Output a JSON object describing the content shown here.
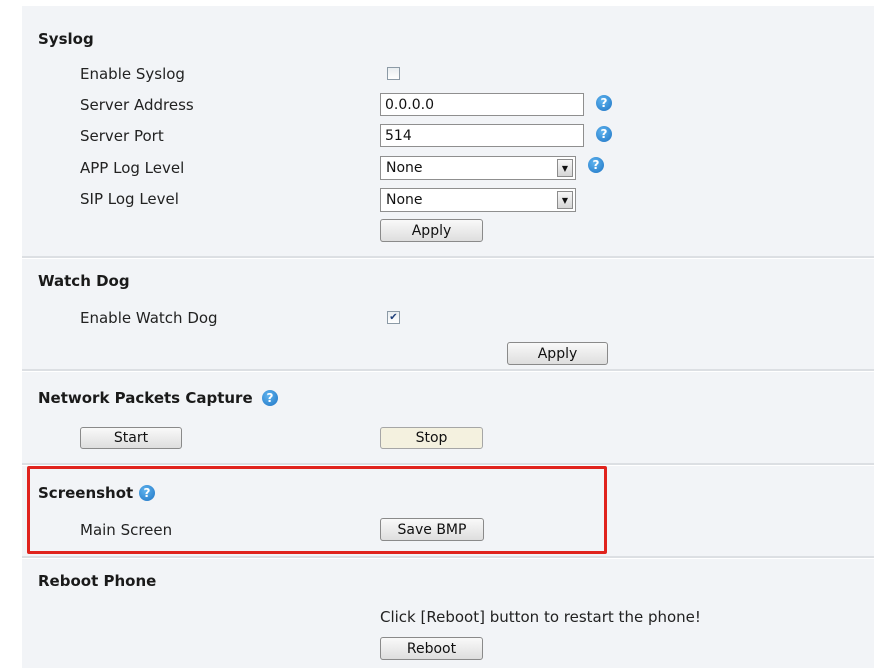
{
  "syslog": {
    "title": "Syslog",
    "enable_label": "Enable Syslog",
    "enable_checked": false,
    "server_address_label": "Server Address",
    "server_address_value": "0.0.0.0",
    "server_port_label": "Server Port",
    "server_port_value": "514",
    "app_log_level_label": "APP Log Level",
    "app_log_level_value": "None",
    "sip_log_level_label": "SIP Log Level",
    "sip_log_level_value": "None",
    "apply_label": "Apply"
  },
  "watch_dog": {
    "title": "Watch Dog",
    "enable_label": "Enable Watch Dog",
    "enable_checked": true,
    "apply_label": "Apply"
  },
  "packet_capture": {
    "title": "Network Packets Capture",
    "start_label": "Start",
    "stop_label": "Stop"
  },
  "screenshot": {
    "title": "Screenshot",
    "main_screen_label": "Main Screen",
    "save_label": "Save BMP"
  },
  "reboot": {
    "title": "Reboot Phone",
    "hint": "Click [Reboot] button to restart the phone!",
    "button_label": "Reboot"
  },
  "icons": {
    "help": "help-icon",
    "checkmark": "checkmark-icon",
    "dropdown": "dropdown-arrow-icon"
  },
  "colors": {
    "highlight": "#e0231d",
    "help_icon": "#2a84d2",
    "panel_bg": "#f2f4f7"
  }
}
